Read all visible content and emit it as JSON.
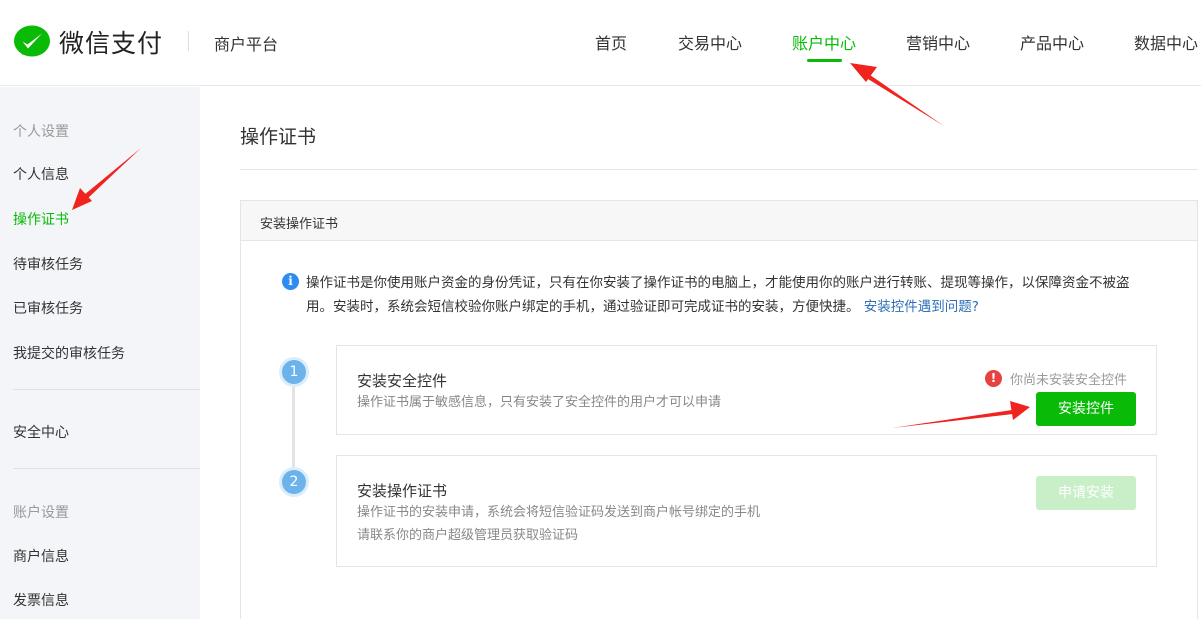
{
  "brand": {
    "name": "微信支付",
    "platform": "商户平台"
  },
  "nav": {
    "items": [
      {
        "label": "首页"
      },
      {
        "label": "交易中心"
      },
      {
        "label": "账户中心"
      },
      {
        "label": "营销中心"
      },
      {
        "label": "产品中心"
      },
      {
        "label": "数据中心"
      }
    ],
    "active_index": 2
  },
  "sidebar": {
    "group_personal": "个人设置",
    "items": [
      {
        "label": "个人信息"
      },
      {
        "label": "操作证书"
      },
      {
        "label": "待审核任务"
      },
      {
        "label": "已审核任务"
      },
      {
        "label": "我提交的审核任务"
      }
    ],
    "security": "安全中心",
    "group_account": "账户设置",
    "account_items": [
      {
        "label": "商户信息"
      },
      {
        "label": "发票信息"
      }
    ]
  },
  "main": {
    "page_title": "操作证书",
    "card_title": "安装操作证书",
    "info": {
      "text": "操作证书是你使用账户资金的身份凭证，只有在你安装了操作证书的电脑上，才能使用你的账户进行转账、提现等操作，以保障资金不被盗用。安装时，系统会短信校验你账户绑定的手机，通过验证即可完成证书的安装，方便快捷。",
      "link": "安装控件遇到问题?"
    },
    "steps": [
      {
        "number": "1",
        "title": "安装安全控件",
        "desc": "操作证书属于敏感信息，只有安装了安全控件的用户才可以申请",
        "warning": "你尚未安装安全控件",
        "button": "安装控件"
      },
      {
        "number": "2",
        "title": "安装操作证书",
        "desc1": "操作证书的安装申请，系统会将短信验证码发送到商户帐号绑定的手机",
        "desc2": "请联系你的商户超级管理员获取验证码",
        "button": "申请安装"
      }
    ]
  },
  "colors": {
    "brand_green": "#09bb07",
    "info_blue": "#2d8cf0",
    "step_blue": "#6cb3ec",
    "warn_red": "#e64340",
    "arrow_red": "#f0231e"
  },
  "icons": [
    "wechat-pay-logo-icon",
    "info-icon",
    "warning-icon",
    "annotation-arrow-icon"
  ]
}
